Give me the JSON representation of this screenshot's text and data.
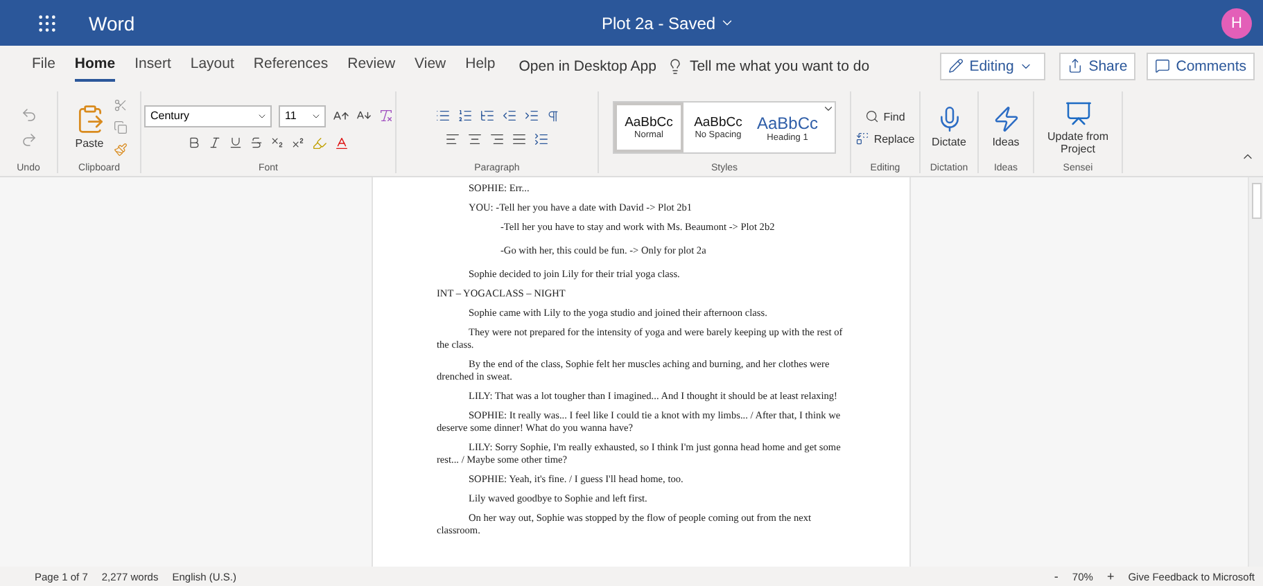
{
  "title_bar": {
    "app": "Word",
    "document": "Plot 2a - Saved",
    "avatar": "H"
  },
  "menu": {
    "tabs": [
      {
        "label": "File",
        "selected": false
      },
      {
        "label": "Home",
        "selected": true
      },
      {
        "label": "Insert",
        "selected": false
      },
      {
        "label": "Layout",
        "selected": false
      },
      {
        "label": "References",
        "selected": false
      },
      {
        "label": "Review",
        "selected": false
      },
      {
        "label": "View",
        "selected": false
      },
      {
        "label": "Help",
        "selected": false
      }
    ],
    "open_desktop": "Open in Desktop App",
    "tell_me": "Tell me what you want to do",
    "mode": "Editing",
    "share": "Share",
    "comments": "Comments"
  },
  "ribbon": {
    "undo_label": "Undo",
    "clipboard": {
      "paste": "Paste",
      "label": "Clipboard"
    },
    "font": {
      "name": "Century",
      "size": "11",
      "label": "Font"
    },
    "paragraph_label": "Paragraph",
    "styles": {
      "items": [
        {
          "sample": "AaBbCc",
          "name": "Normal",
          "kind": "normal",
          "selected": true
        },
        {
          "sample": "AaBbCc",
          "name": "No Spacing",
          "kind": "normal",
          "selected": false
        },
        {
          "sample": "AaBbCc",
          "name": "Heading 1",
          "kind": "heading",
          "selected": false
        }
      ],
      "label": "Styles"
    },
    "editing": {
      "find": "Find",
      "replace": "Replace",
      "label": "Editing"
    },
    "dictation": {
      "button": "Dictate",
      "label": "Dictation"
    },
    "ideas": {
      "button": "Ideas",
      "label": "Ideas"
    },
    "sensei": {
      "button": "Update from Project",
      "label": "Sensei"
    }
  },
  "document": {
    "paragraphs": [
      {
        "kind": "indent",
        "text": "SOPHIE: Err..."
      },
      {
        "kind": "indent",
        "text": "YOU: -Tell her you have a date with David -> Plot 2b1"
      },
      {
        "kind": "choice",
        "text": "-Tell her you have to stay and work with Ms. Beaumont -> Plot 2b2"
      },
      {
        "kind": "choice",
        "text": "-Go with her, this could be fun. -> Only for plot 2a"
      },
      {
        "kind": "indent",
        "text": "Sophie decided to join Lily for their trial yoga class."
      },
      {
        "kind": "heading",
        "text": "INT – YOGACLASS – NIGHT"
      },
      {
        "kind": "indent",
        "text": "Sophie came with Lily to the yoga studio and joined their afternoon class."
      },
      {
        "kind": "indent",
        "text": "They were not prepared for the intensity of yoga and were barely keeping up with the rest of the class."
      },
      {
        "kind": "indent",
        "text": "By the end of the class, Sophie felt her muscles aching and burning, and her clothes were drenched in sweat."
      },
      {
        "kind": "indent",
        "text": "LILY: That was a lot tougher than I imagined... And I thought it should be at least relaxing!"
      },
      {
        "kind": "indent",
        "text": "SOPHIE: It really was... I feel like I could tie a knot with my limbs... / After that, I think we deserve some dinner! What do you wanna have?"
      },
      {
        "kind": "indent",
        "text": "LILY: Sorry Sophie, I'm really exhausted, so I think I'm just gonna head home and get some rest... / Maybe some other time?"
      },
      {
        "kind": "indent",
        "text": "SOPHIE: Yeah, it's fine. / I guess I'll head home, too."
      },
      {
        "kind": "indent",
        "text": "Lily waved goodbye to Sophie and left first."
      },
      {
        "kind": "indent",
        "text": "On her way out, Sophie was stopped by the flow of people coming out from the next classroom."
      }
    ]
  },
  "status_bar": {
    "page": "Page 1 of 7",
    "words": "2,277 words",
    "language": "English (U.S.)",
    "zoom_out": "-",
    "zoom": "70%",
    "zoom_in": "+",
    "feedback": "Give Feedback to Microsoft"
  }
}
